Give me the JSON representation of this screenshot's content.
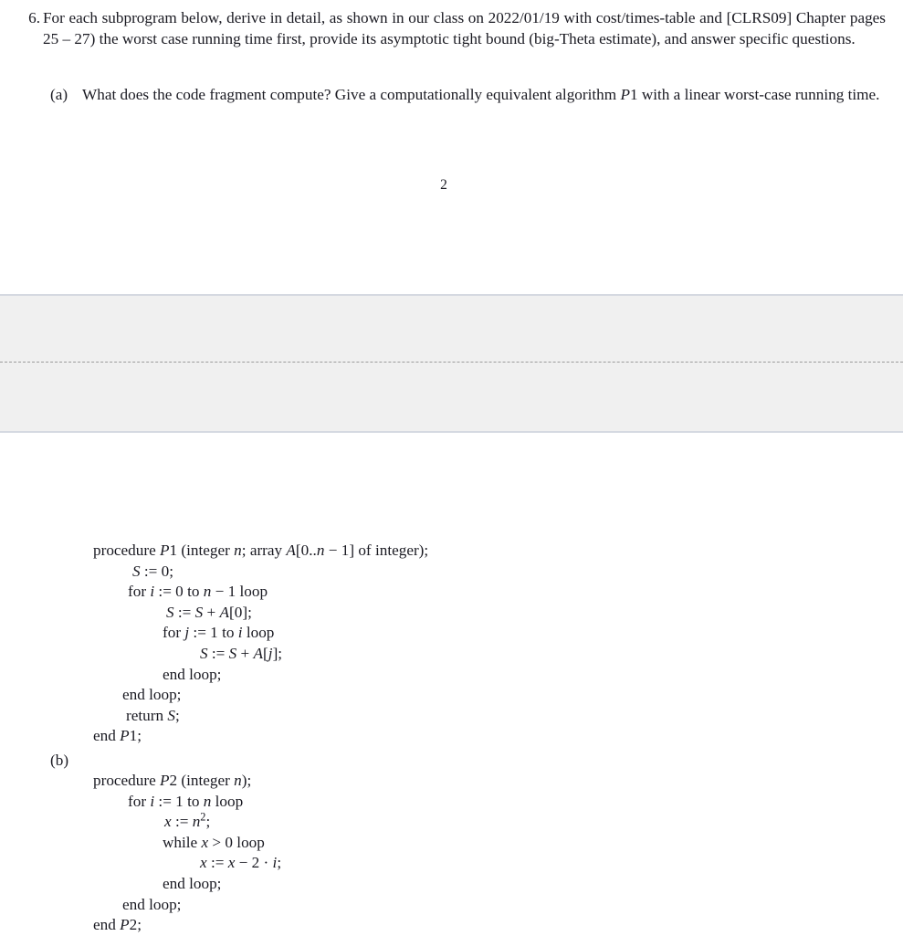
{
  "document": {
    "page_number": "2",
    "problem": {
      "marker": "6.",
      "text": "For each subprogram below, derive in detail, as shown in our class on 2022/01/19 with cost/times-table and [CLRS09] Chapter pages 25 – 27) the worst case running time first, provide its asymptotic tight bound (big-Theta estimate), and answer specific questions."
    },
    "sub_items": [
      {
        "marker": "(a)",
        "text": "What does the code fragment compute?  Give a computationally equivalent algorithm P1 with a linear worst-case running time."
      },
      {
        "marker": "(b)",
        "text": ""
      }
    ],
    "code_p1": {
      "name": "P1",
      "lines": [
        "procedure P1 (integer n; array A[0..n − 1] of integer);",
        "S := 0;",
        "for i := 0 to n − 1 loop",
        "S := S + A[0];",
        "for j := 1 to i loop",
        "S := S + A[j];",
        "end loop;",
        "end loop;",
        "return S;",
        "end P1;"
      ]
    },
    "code_p2": {
      "name": "P2",
      "lines": [
        "procedure P2 (integer n);",
        "for i := 1 to n loop",
        "x := n²;",
        "while x > 0 loop",
        "x := x − 2 · i;",
        "end loop;",
        "end loop;",
        "end P2;"
      ]
    },
    "page_gap": {
      "background_color": "#f0f0f0",
      "border_color": "#d5d9e1",
      "divider_color": "#9b9b9b"
    }
  }
}
